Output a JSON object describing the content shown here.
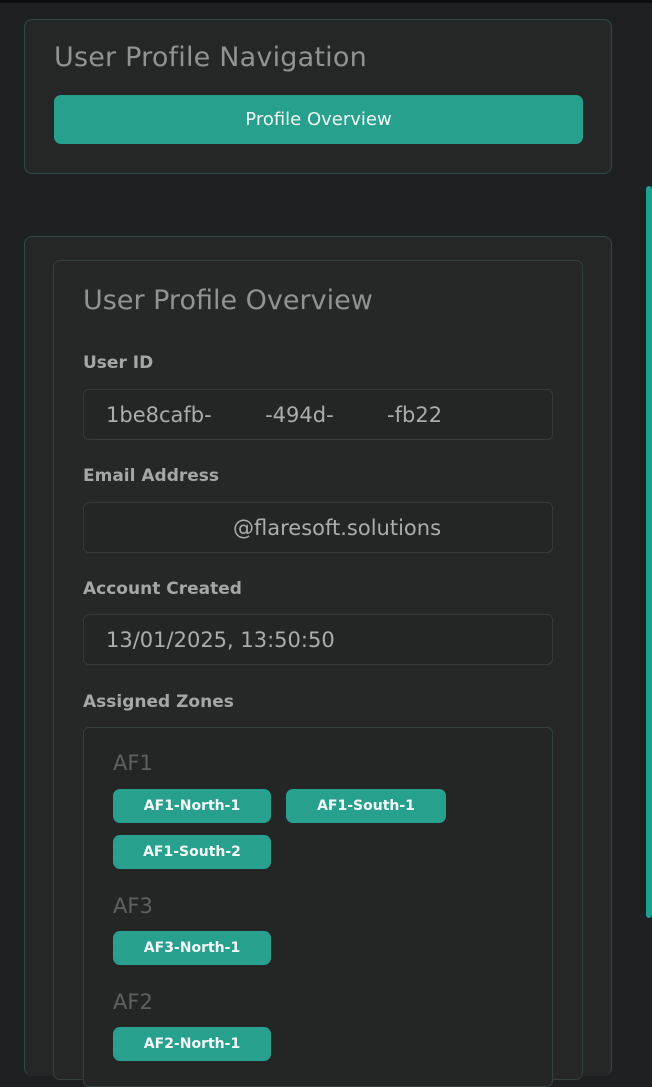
{
  "navigation": {
    "title": "User Profile Navigation",
    "button_label": "Profile Overview"
  },
  "overview": {
    "title": "User Profile Overview",
    "user_id": {
      "label": "User ID",
      "value": "1be8cafb-        -494d-        -fb22"
    },
    "email": {
      "label": "Email Address",
      "value": "@flaresoft.solutions"
    },
    "account_created": {
      "label": "Account Created",
      "value": "13/01/2025, 13:50:50"
    },
    "assigned_zones": {
      "label": "Assigned Zones",
      "groups": [
        {
          "name": "AF1",
          "zones": [
            "AF1-North-1",
            "AF1-South-1",
            "AF1-South-2"
          ]
        },
        {
          "name": "AF3",
          "zones": [
            "AF3-North-1"
          ]
        },
        {
          "name": "AF2",
          "zones": [
            "AF2-North-1"
          ]
        }
      ]
    }
  },
  "colors": {
    "accent": "#28a08e",
    "background": "#1e1f20",
    "card": "#252727"
  }
}
